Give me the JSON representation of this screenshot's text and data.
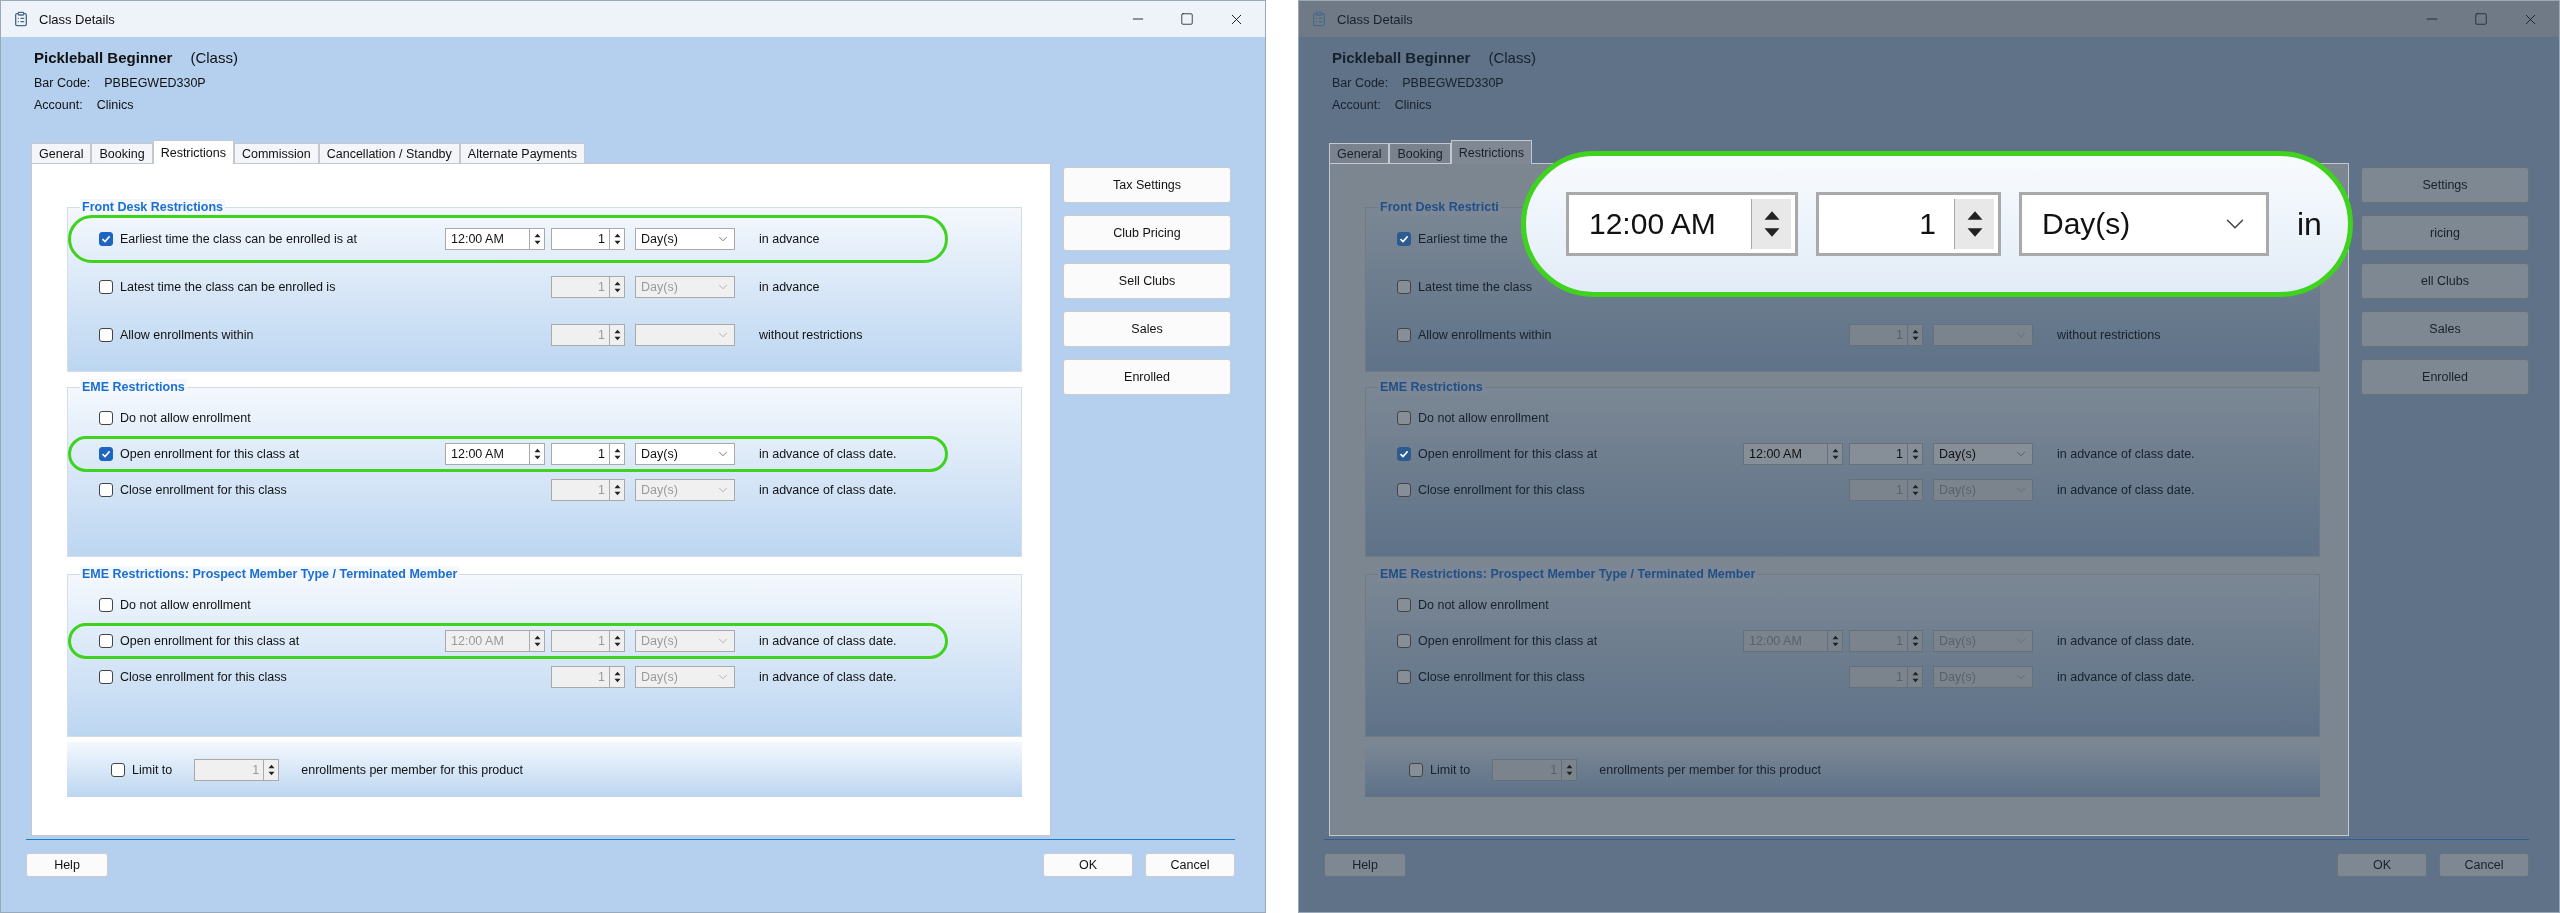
{
  "panels": [
    {
      "dimmed": false,
      "window": {
        "title": "Class Details"
      },
      "header": {
        "name": "Pickleball Beginner",
        "type": "(Class)",
        "fields": [
          {
            "label": "Bar Code:",
            "value": "PBBEGWED330P"
          },
          {
            "label": "Account:",
            "value": "Clinics"
          }
        ]
      },
      "tabs": [
        {
          "label": "General",
          "selected": false
        },
        {
          "label": "Booking",
          "selected": false
        },
        {
          "label": "Restrictions",
          "selected": true
        },
        {
          "label": "Commission",
          "selected": false
        },
        {
          "label": "Cancellation / Standby",
          "selected": false
        },
        {
          "label": "Alternate Payments",
          "selected": false
        }
      ],
      "groups": [
        {
          "title": "Front Desk Restrictions",
          "rows": [
            {
              "label": "Earliest time the class can be enrolled is at",
              "checked": true,
              "highlighted": true,
              "time": {
                "value": "12:00 AM",
                "disabled": false
              },
              "count": {
                "value": "1",
                "disabled": false
              },
              "unit": {
                "value": "Day(s)",
                "disabled": false
              },
              "suffix": "in advance"
            },
            {
              "label": "Latest time the class can be enrolled is",
              "checked": false,
              "highlighted": false,
              "count": {
                "value": "1",
                "disabled": true
              },
              "unit": {
                "value": "Day(s)",
                "disabled": true
              },
              "suffix": "in advance"
            },
            {
              "label": "Allow enrollments within",
              "checked": false,
              "highlighted": false,
              "count": {
                "value": "1",
                "disabled": true
              },
              "unit": {
                "disabled": true
              },
              "suffix": "without restrictions"
            }
          ]
        },
        {
          "title": "EME Restrictions",
          "rows": [
            {
              "label": "Do not allow enrollment",
              "checked": false,
              "highlighted": false
            },
            {
              "label": "Open enrollment for this class at",
              "checked": true,
              "highlighted": true,
              "time": {
                "value": "12:00 AM",
                "disabled": false
              },
              "count": {
                "value": "1",
                "disabled": false
              },
              "unit": {
                "value": "Day(s)",
                "disabled": false
              },
              "suffix": "in advance of class date."
            },
            {
              "label": "Close enrollment for this class",
              "checked": false,
              "highlighted": false,
              "count": {
                "value": "1",
                "disabled": true
              },
              "unit": {
                "value": "Day(s)",
                "disabled": true
              },
              "suffix": "in advance of class date."
            }
          ]
        },
        {
          "title": "EME Restrictions: Prospect Member Type / Terminated Member",
          "rows": [
            {
              "label": "Do not allow enrollment",
              "checked": false,
              "highlighted": false
            },
            {
              "label": "Open enrollment for this class at",
              "checked": false,
              "highlighted": true,
              "time": {
                "value": "12:00 AM",
                "disabled": true
              },
              "count": {
                "value": "1",
                "disabled": true
              },
              "unit": {
                "value": "Day(s)",
                "disabled": true
              },
              "suffix": "in advance of class date."
            },
            {
              "label": "Close enrollment for this class",
              "checked": false,
              "highlighted": false,
              "count": {
                "value": "1",
                "disabled": true
              },
              "unit": {
                "value": "Day(s)",
                "disabled": true
              },
              "suffix": "in advance of class date."
            }
          ]
        }
      ],
      "limit": {
        "label": "Limit to",
        "checked": false,
        "count": {
          "value": "1",
          "disabled": true
        },
        "suffix": "enrollments per member for this product"
      },
      "side_buttons": [
        "Tax Settings",
        "Club Pricing",
        "Sell Clubs",
        "Sales",
        "Enrolled"
      ],
      "footer": {
        "help": "Help",
        "ok": "OK",
        "cancel": "Cancel"
      }
    },
    {
      "dimmed": true,
      "window": {
        "title": "Class Details"
      },
      "header": {
        "name": "Pickleball Beginner",
        "type": "(Class)",
        "fields": [
          {
            "label": "Bar Code:",
            "value": "PBBEGWED330P"
          },
          {
            "label": "Account:",
            "value": "Clinics"
          }
        ]
      },
      "tabs": [
        {
          "label": "General",
          "selected": false
        },
        {
          "label": "Booking",
          "selected": false
        },
        {
          "label": "Restrictions",
          "selected": true
        }
      ],
      "groups": [
        {
          "title": "Front Desk Restricti",
          "rows": [
            {
              "label": "Earliest time the",
              "checked": true,
              "highlighted": false
            },
            {
              "label": "Latest time the class",
              "checked": false,
              "highlighted": false
            },
            {
              "label": "Allow enrollments within",
              "checked": false,
              "highlighted": false,
              "count": {
                "value": "1",
                "disabled": true
              },
              "unit": {
                "disabled": true
              },
              "suffix": "without restrictions"
            }
          ]
        },
        {
          "title": "EME Restrictions",
          "rows": [
            {
              "label": "Do not allow enrollment",
              "checked": false,
              "highlighted": false
            },
            {
              "label": "Open enrollment for this class at",
              "checked": true,
              "highlighted": false,
              "time": {
                "value": "12:00 AM",
                "disabled": false
              },
              "count": {
                "value": "1",
                "disabled": false
              },
              "unit": {
                "value": "Day(s)",
                "disabled": false
              },
              "suffix": "in advance of class date."
            },
            {
              "label": "Close enrollment for this class",
              "checked": false,
              "highlighted": false,
              "count": {
                "value": "1",
                "disabled": true
              },
              "unit": {
                "value": "Day(s)",
                "disabled": true
              },
              "suffix": "in advance of class date."
            }
          ]
        },
        {
          "title": "EME Restrictions: Prospect Member Type / Terminated Member",
          "rows": [
            {
              "label": "Do not allow enrollment",
              "checked": false,
              "highlighted": false
            },
            {
              "label": "Open enrollment for this class at",
              "checked": false,
              "highlighted": false,
              "time": {
                "value": "12:00 AM",
                "disabled": true
              },
              "count": {
                "value": "1",
                "disabled": true
              },
              "unit": {
                "value": "Day(s)",
                "disabled": true
              },
              "suffix": "in advance of class date."
            },
            {
              "label": "Close enrollment for this class",
              "checked": false,
              "highlighted": false,
              "count": {
                "value": "1",
                "disabled": true
              },
              "unit": {
                "value": "Day(s)",
                "disabled": true
              },
              "suffix": "in advance of class date."
            }
          ]
        }
      ],
      "limit": {
        "label": "Limit to",
        "checked": false,
        "count": {
          "value": "1",
          "disabled": true
        },
        "suffix": "enrollments per member for this product"
      },
      "side_buttons": [
        "Settings",
        "ricing",
        "ell Clubs",
        "Sales",
        "Enrolled"
      ],
      "footer": {
        "help": "Help",
        "ok": "OK",
        "cancel": "Cancel"
      },
      "callout": {
        "time": "12:00 AM",
        "count": "1",
        "unit": "Day(s)",
        "suffix": "in"
      }
    }
  ]
}
